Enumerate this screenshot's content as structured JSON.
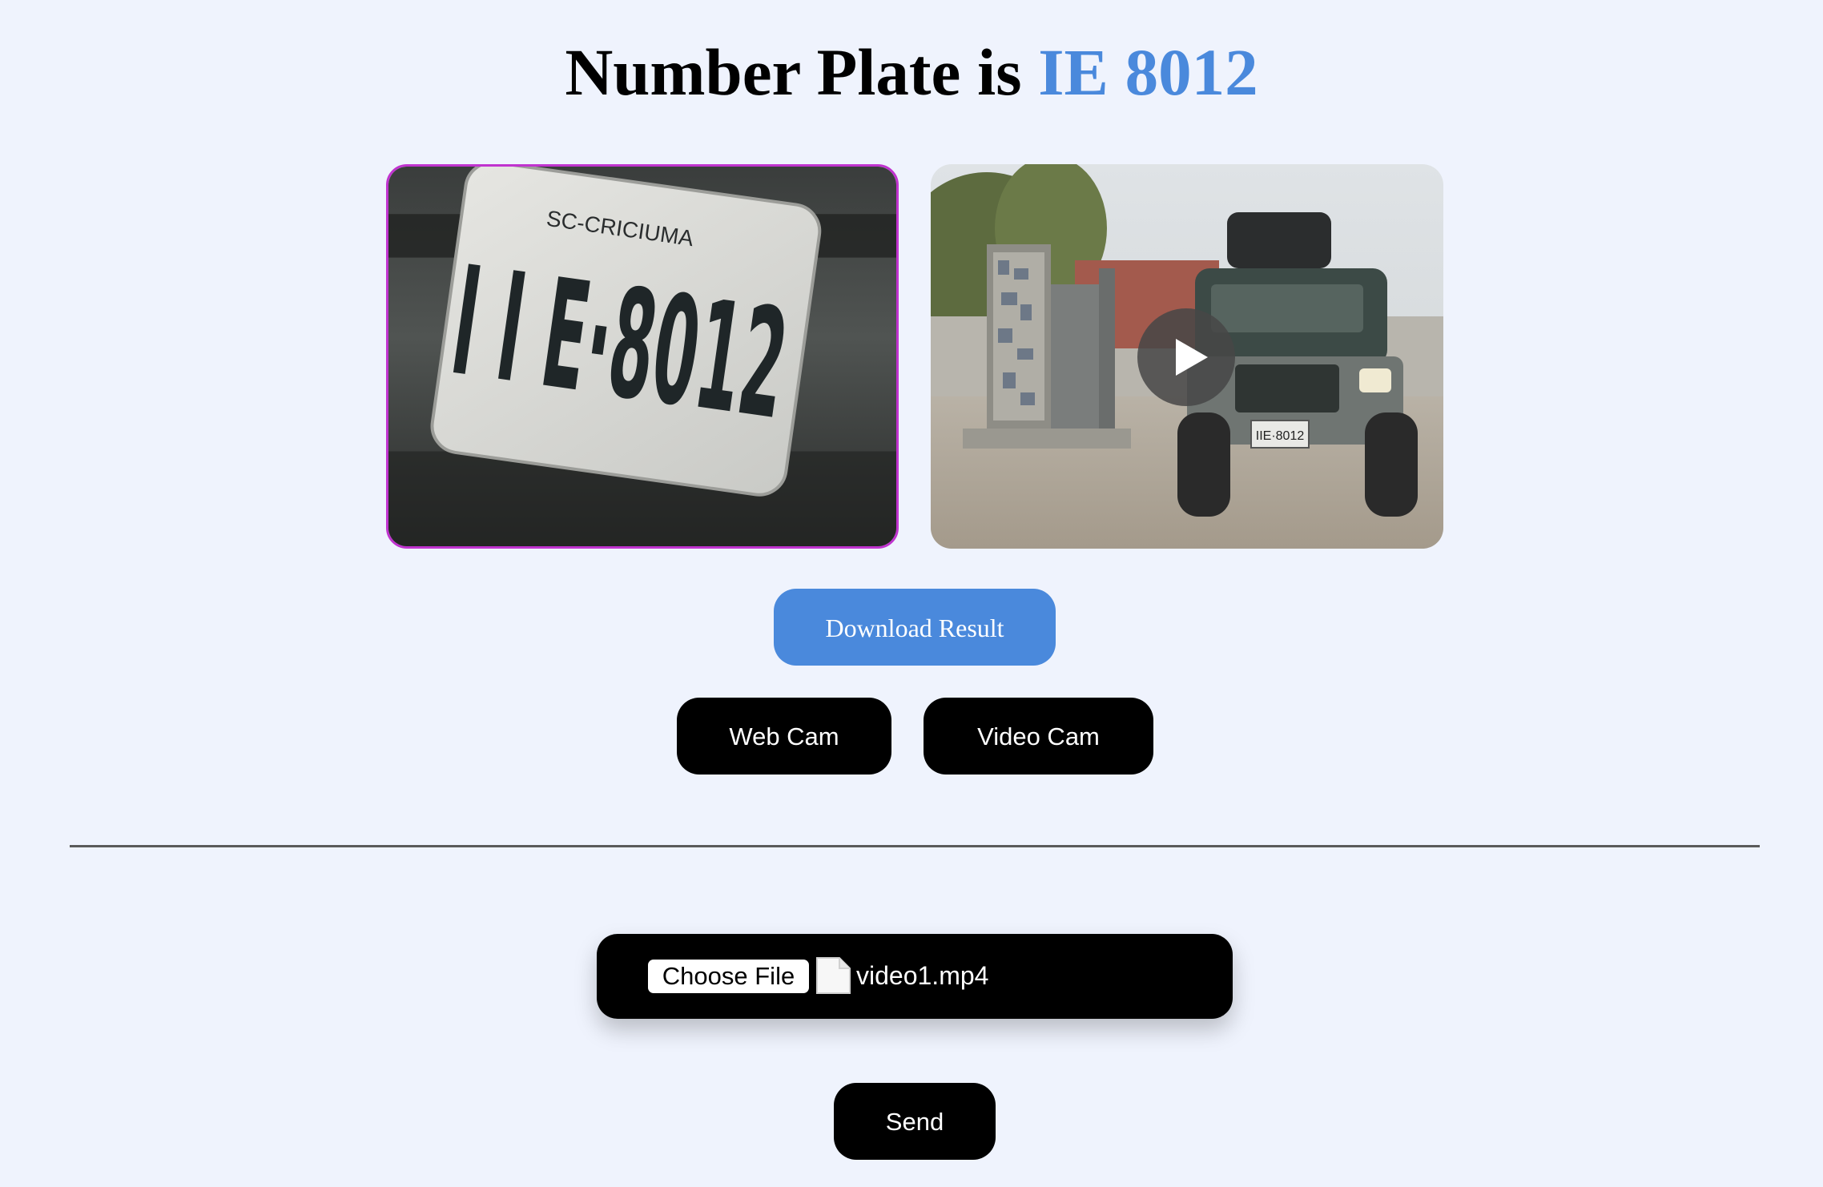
{
  "header": {
    "title_prefix": "Number Plate is",
    "plate_number": "IE 8012",
    "plate_color": "#4a89dc"
  },
  "media": {
    "plate_crop": {
      "plate_text": "I I E·8012",
      "plate_region_text": "SC-CRICIUMA",
      "border_color": "#c033cf"
    },
    "video": {
      "vehicle_plate_text": "IIE·8012",
      "play_icon": "play-icon"
    }
  },
  "actions": {
    "download_label": "Download Result",
    "webcam_label": "Web Cam",
    "videocam_label": "Video Cam"
  },
  "upload": {
    "choose_file_label": "Choose File",
    "file_icon": "file-icon",
    "selected_file": "video1.mp4",
    "send_label": "Send"
  },
  "colors": {
    "background": "#eff3fd",
    "accent": "#4a89dc",
    "button_dark": "#000000"
  }
}
